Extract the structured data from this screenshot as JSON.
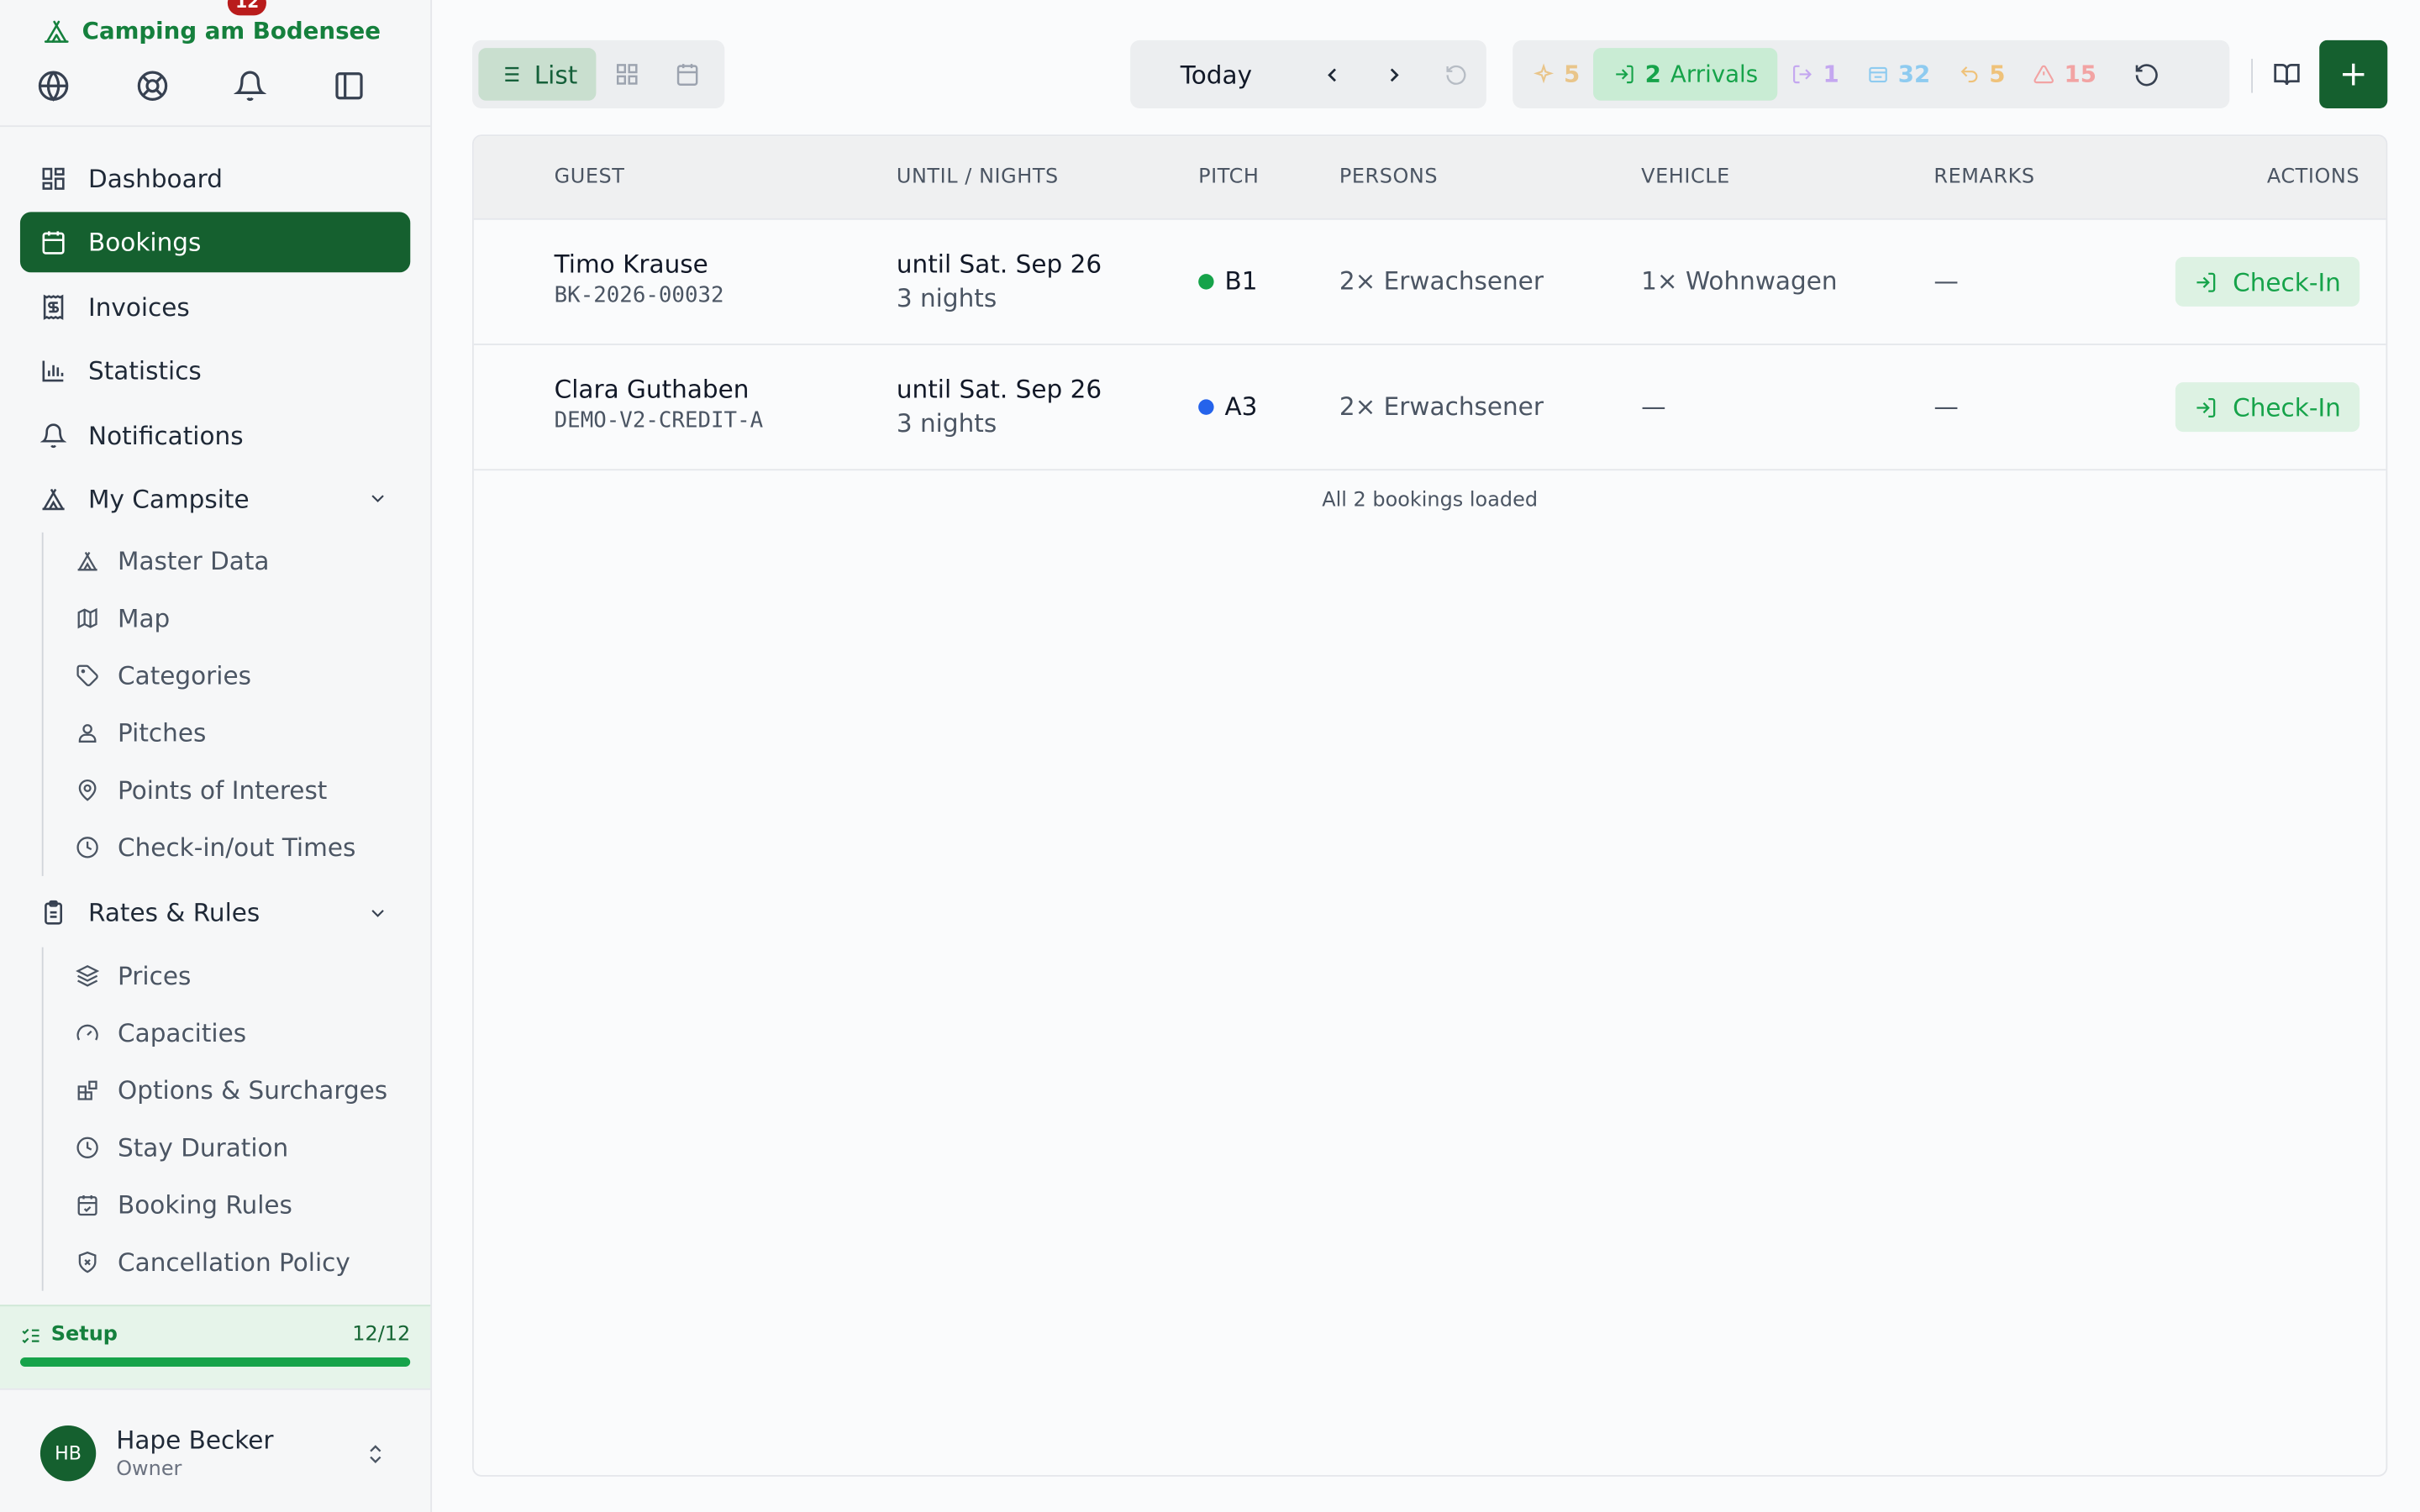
{
  "brand": {
    "name": "Camping am Bodensee"
  },
  "top_icons": [
    {
      "name": "globe-icon"
    },
    {
      "name": "lifebuoy-icon"
    },
    {
      "name": "bell-icon",
      "badge": "12"
    },
    {
      "name": "sidebar-toggle-icon"
    }
  ],
  "sidebar": {
    "items": [
      {
        "label": "Dashboard",
        "icon": "dashboard-icon"
      },
      {
        "label": "Bookings",
        "icon": "calendar-icon",
        "active": true
      },
      {
        "label": "Invoices",
        "icon": "invoice-icon"
      },
      {
        "label": "Statistics",
        "icon": "chart-icon"
      },
      {
        "label": "Notifications",
        "icon": "bell-icon"
      }
    ],
    "campsite": {
      "label": "My Campsite",
      "items": [
        "Master Data",
        "Map",
        "Categories",
        "Pitches",
        "Points of Interest",
        "Check-in/out Times"
      ]
    },
    "rates": {
      "label": "Rates & Rules",
      "items": [
        "Prices",
        "Capacities",
        "Options & Surcharges",
        "Stay Duration",
        "Booking Rules",
        "Cancellation Policy"
      ]
    }
  },
  "setup": {
    "label": "Setup",
    "progress": "12/12",
    "fraction": 1.0
  },
  "user": {
    "initials": "HB",
    "name": "Hape Becker",
    "role": "Owner"
  },
  "toolbar": {
    "view_list_label": "List",
    "today_label": "Today",
    "stats": [
      {
        "value": "5",
        "icon": "sparkle-icon",
        "color": "#e9c58a"
      },
      {
        "value": "2",
        "label": "Arrivals",
        "icon": "arrival-icon",
        "color": "#16a34a"
      },
      {
        "value": "1",
        "icon": "departure-icon",
        "color": "#c4a7f0"
      },
      {
        "value": "32",
        "icon": "occupied-icon",
        "color": "#8ecbf0"
      },
      {
        "value": "5",
        "icon": "return-icon",
        "color": "#efc27a"
      },
      {
        "value": "15",
        "icon": "warning-icon",
        "color": "#f2a3a3"
      }
    ]
  },
  "table": {
    "headers": [
      "GUEST",
      "UNTIL / NIGHTS",
      "PITCH",
      "PERSONS",
      "VEHICLE",
      "REMARKS",
      "ACTIONS"
    ],
    "rows": [
      {
        "guest": "Timo Krause",
        "ref": "BK-2026-00032",
        "until": "until Sat. Sep 26",
        "nights": "3 nights",
        "pitch": "B1",
        "pitch_color": "#16a34a",
        "persons": "2× Erwachsener",
        "vehicle": "1× Wohnwagen",
        "remarks": "—",
        "action": "Check-In"
      },
      {
        "guest": "Clara Guthaben",
        "ref": "DEMO-V2-CREDIT-A",
        "until": "until Sat. Sep 26",
        "nights": "3 nights",
        "pitch": "A3",
        "pitch_color": "#2563eb",
        "persons": "2× Erwachsener",
        "vehicle": "—",
        "remarks": "—",
        "action": "Check-In"
      }
    ],
    "footer": "All 2 bookings loaded"
  }
}
